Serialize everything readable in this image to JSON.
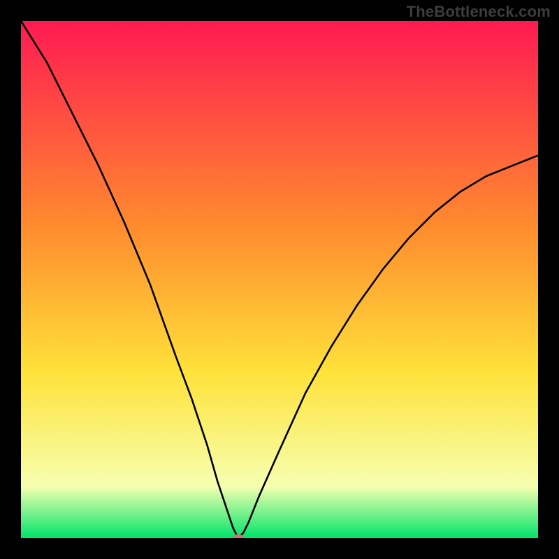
{
  "attribution": "TheBottleneck.com",
  "colors": {
    "gradient_top": "#ff1a52",
    "gradient_mid1": "#ff8c2e",
    "gradient_mid2": "#ffe23a",
    "gradient_mid3": "#f6ffb0",
    "gradient_bottom": "#00e46a",
    "curve": "#000000",
    "marker": "#c97474",
    "frame": "#000000"
  },
  "chart_data": {
    "type": "line",
    "title": "",
    "xlabel": "",
    "ylabel": "",
    "xlim": [
      0,
      100
    ],
    "ylim": [
      0,
      100
    ],
    "grid": false,
    "legend": false,
    "annotations": [
      "TheBottleneck.com"
    ],
    "optimum_x": 42,
    "series": [
      {
        "name": "bottleneck-curve",
        "x": [
          0,
          5,
          10,
          15,
          20,
          25,
          30,
          33,
          36,
          38,
          40,
          41,
          42,
          43,
          44,
          46,
          50,
          55,
          60,
          65,
          70,
          75,
          80,
          85,
          90,
          95,
          100
        ],
        "y": [
          100,
          92,
          82,
          72,
          61,
          49,
          35,
          27,
          18,
          11,
          5,
          2,
          0,
          1,
          3,
          8,
          17,
          28,
          37,
          45,
          52,
          58,
          63,
          67,
          70,
          72,
          74
        ]
      }
    ],
    "marker": {
      "x": 42,
      "y": 0
    },
    "background_bands": [
      {
        "from_y": 85,
        "to_y": 100,
        "color": "#ff1a52"
      },
      {
        "from_y": 55,
        "to_y": 85,
        "color": "#ff8c2e"
      },
      {
        "from_y": 18,
        "to_y": 55,
        "color": "#ffe23a"
      },
      {
        "from_y": 5,
        "to_y": 18,
        "color": "#f6ffb0"
      },
      {
        "from_y": 0,
        "to_y": 5,
        "color": "#00e46a"
      }
    ]
  }
}
